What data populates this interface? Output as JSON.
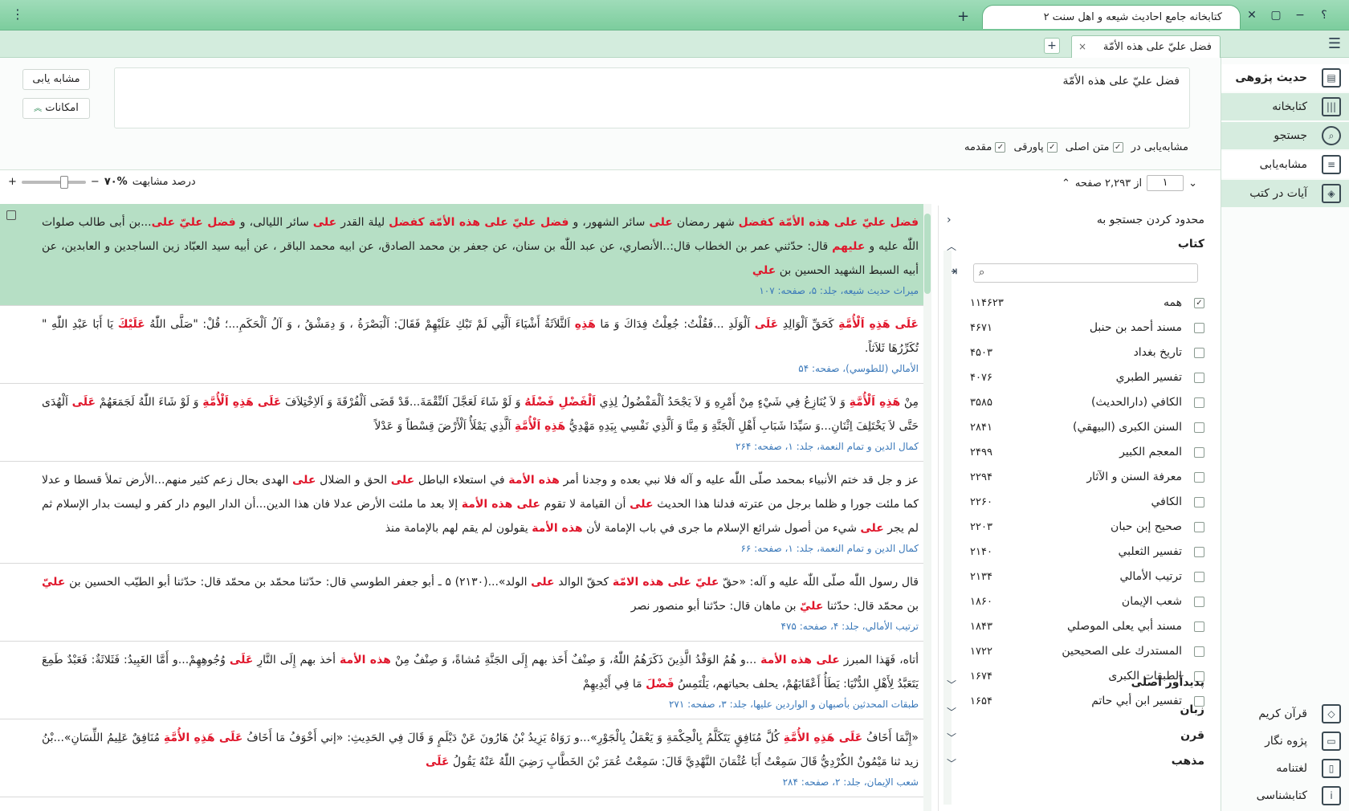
{
  "titlebar": {
    "app_title": "کتابخانه جامع احادیث شیعه و اهل سنت ۲",
    "help": "؟",
    "minimize": "−",
    "restore": "▢",
    "close": "✕",
    "new_tab": "+",
    "kebab": "⋮"
  },
  "doc_tabs": {
    "active_label": "فضل عليّ على هذه الأمّة",
    "close": "×",
    "add": "+"
  },
  "sidebar": {
    "menu": "☰",
    "items": [
      {
        "label": "حدیث پژوهی",
        "icon": "hadith-research-icon"
      },
      {
        "label": "کتابخانه",
        "icon": "library-icon"
      },
      {
        "label": "جستجو",
        "icon": "search-icon"
      },
      {
        "label": "مشابه‌یابی",
        "icon": "similarity-icon"
      },
      {
        "label": "آیات در کتب",
        "icon": "verses-icon"
      }
    ],
    "tools": [
      {
        "label": "قرآن کریم",
        "icon": "quran-icon"
      },
      {
        "label": "پژوه نگار",
        "icon": "notes-icon"
      },
      {
        "label": "لغتنامه",
        "icon": "dictionary-icon"
      },
      {
        "label": "کتابشناسی",
        "icon": "info-icon"
      }
    ]
  },
  "search": {
    "query": "فضل عليّ على هذه الأمّة",
    "similar_button": "مشابه یابی",
    "options_button": "امکانات",
    "scope_label": "مشابه‌یابی در",
    "checks": [
      {
        "label": "متن اصلی",
        "checked": true
      },
      {
        "label": "پاورقی",
        "checked": true
      },
      {
        "label": "مقدمه",
        "checked": true
      }
    ],
    "similarity_label": "درصد مشابهت",
    "similarity_value": "۷۰%",
    "minus": "−",
    "plus": "+"
  },
  "pager": {
    "current": "۱",
    "of_label": "از ۲,۲۹۳ صفحه"
  },
  "results": [
    {
      "text": [
        [
          "hi",
          "فضل عليّ على هذه الأمّة كفضل"
        ],
        [
          "n",
          " شهر رمضان "
        ],
        [
          "hi",
          "على"
        ],
        [
          "n",
          " سائر الشهور، و "
        ],
        [
          "hi",
          "فضل عليّ على هذه الأمّة كفضل"
        ],
        [
          "n",
          " ليلة القدر "
        ],
        [
          "hi",
          "على"
        ],
        [
          "n",
          " سائر الليالى، و "
        ],
        [
          "hi",
          "فضل عليّ على"
        ],
        [
          "n",
          "...بن أبى طالب صلوات اللّٰه عليه و "
        ],
        [
          "hi",
          "عليهم"
        ],
        [
          "n",
          " قال: حدّثني عمر بن الخطاب قال:..الأنصاري، عن عبد اللّٰه بن سنان، عن جعفر بن محمد الصادق، عن ابيه محمد الباقر ، عن أبيه سيد العبّاد زين الساجدين و العابدين، عن أبيه السبط الشهيد الحسين بن "
        ],
        [
          "hi",
          "علي"
        ]
      ],
      "ref": "ميراث حديث شيعه، جلد: ۵، صفحه: ۱۰۷"
    },
    {
      "text": [
        [
          "hi",
          "عَلَى هَذِهِ اَلْأُمَّةِ"
        ],
        [
          "n",
          " كَحَقِّ اَلْوَالِدِ "
        ],
        [
          "hi",
          "عَلَى"
        ],
        [
          "n",
          " اَلْوَلَدِ ...فَقُلْتُ: جُعِلْتُ فِدَاكَ وَ مَا "
        ],
        [
          "hi",
          "هَذِهِ"
        ],
        [
          "n",
          " اَلثَّلاَثَةُ أَشْيَاءَ اَلَّتِي لَمْ تَبْكِ عَلَيْهِمْ فَقَالَ: اَلْبَصْرَةُ ، وَ دِمَشْقُ ، وَ آلُ اَلْحَكَمِ...؛ قُلْ: \"صَلَّى اللّٰهُ "
        ],
        [
          "hi",
          "عَلَيْكَ"
        ],
        [
          "n",
          " يَا أَبَا عَبْدِ اللّٰهِ \" تُكَرِّرُهَا ثَلاَثاً."
        ]
      ],
      "ref": "الأمالي (للطوسي)، صفحه: ۵۴"
    },
    {
      "text": [
        [
          "n",
          "مِنْ "
        ],
        [
          "hi",
          "هَذِهِ اَلْأُمَّةِ"
        ],
        [
          "n",
          " وَ لاَ يُنَازِعُ فِي شَيْءٍ مِنْ أَمْرِهِ وَ لاَ يَجْحَدُ اَلْمَفْضُولُ لِذِي "
        ],
        [
          "hi",
          "اَلْفَضْلِ فَضْلَهُ"
        ],
        [
          "n",
          " وَ لَوْ شَاءَ لَعَجَّلَ اَلنِّقْمَةَ...قَدْ قَضَى اَلْفُرْقَةَ وَ اَلاِخْتِلاَفَ "
        ],
        [
          "hi",
          "عَلَى هَذِهِ اَلْأُمَّةِ"
        ],
        [
          "n",
          " وَ لَوْ شَاءَ اللّٰهُ لَجَمَعَهُمْ "
        ],
        [
          "hi",
          "عَلَى"
        ],
        [
          "n",
          " اَلْهُدَى حَتَّى لاَ يَخْتَلِفَ اِثْنَانِ...وَ سَيِّدَا شَبَابِ أَهْلِ اَلْجَنَّةِ وَ مِنَّا وَ اَلَّذِي نَفْسِي بِيَدِهِ مَهْدِيُّ "
        ],
        [
          "hi",
          "هَذِهِ اَلْأُمَّةِ"
        ],
        [
          "n",
          " اَلَّذِي يَمْلَأُ اَلْأَرْضَ قِسْطاً وَ عَدْلاً"
        ]
      ],
      "ref": "كمال الدين و تمام النعمة، جلد: ۱، صفحه: ۲۶۴"
    },
    {
      "text": [
        [
          "n",
          "عز و جل قد ختم الأنبياء بمحمد صلّى اللّٰه عليه و آله فلا نبي بعده و وجدنا أمر "
        ],
        [
          "hi",
          "هذه الأمة"
        ],
        [
          "n",
          " في استعلاء الباطل "
        ],
        [
          "hi",
          "على"
        ],
        [
          "n",
          " الحق و الضلال "
        ],
        [
          "hi",
          "على"
        ],
        [
          "n",
          " الهدى بحال زعم كثير منهم...الأرض تملأ قسطا و عدلا كما ملئت جورا و ظلما برجل من عترته فدلنا هذا الحديث "
        ],
        [
          "hi",
          "على"
        ],
        [
          "n",
          " أن القيامة لا تقوم "
        ],
        [
          "hi",
          "على هذه الأمة"
        ],
        [
          "n",
          " إلا بعد ما ملئت الأرض عدلا فان هذا الدين...أن الدار اليوم دار كفر و ليست بدار الإسلام ثم لم يجر "
        ],
        [
          "hi",
          "على"
        ],
        [
          "n",
          " شيء من أصول شرائع الإسلام ما جرى في باب الإمامة لأن "
        ],
        [
          "hi",
          "هذه الأمة"
        ],
        [
          "n",
          " يقولون لم يقم لهم بالإمامة منذ"
        ]
      ],
      "ref": "كمال الدين و تمام النعمة، جلد: ۱، صفحه: ۶۶"
    },
    {
      "text": [
        [
          "n",
          "قال رسول اللّٰه صلّى اللّٰه عليه و آله: «حقّ "
        ],
        [
          "hi",
          "عليّ على هذه الامّة"
        ],
        [
          "n",
          " كحقّ الوالد "
        ],
        [
          "hi",
          "على"
        ],
        [
          "n",
          " الولد»...(۲۱۳۰) ۵ ـ أبو جعفر الطوسي قال: حدّثنا محمّد بن محمّد قال: حدّثنا أبو الطيّب الحسين بن "
        ],
        [
          "hi",
          "عليّ"
        ],
        [
          "n",
          " بن محمّد قال: حدّثنا "
        ],
        [
          "hi",
          "عليّ"
        ],
        [
          "n",
          " بن ماهان قال: حدّثنا أبو منصور نصر"
        ]
      ],
      "ref": "ترتيب الأمالي، جلد: ۴، صفحه: ۴۷۵"
    },
    {
      "text": [
        [
          "n",
          "أتاه، فَهَذا المبرز "
        ],
        [
          "hi",
          "على هذه الأمة"
        ],
        [
          "n",
          " ...و هُمُ الوَفْدُ الَّذِينَ ذَكَرَهُمُ اللّٰهُ، وَ صِنْفٌ أَخَذ بهم إِلَى الجَنَّةِ مُشاةً، وَ صِنْفٌ مِنْ "
        ],
        [
          "hi",
          "هذه الأمة"
        ],
        [
          "n",
          " أخذ بهم إِلَى النَّارِ "
        ],
        [
          "hi",
          "عَلَى"
        ],
        [
          "n",
          " وُجُوهِهِمْ...و أَمَّا الغَبِيدُ: فَثَلاثَةٌ: فَعَبْدٌ طَمِعَ يَتَعَبَّدُ لِأَهْلِ الدُّنْيَا: يَطَأُ أَعْقَابَهُمْ، يحلف بحياتهم، يَلْتَمِسُ "
        ],
        [
          "hi",
          "فَضْلَ"
        ],
        [
          "n",
          " مَا فِي أَيْدِيهِمْ"
        ]
      ],
      "ref": "طبقات المحدثين بأصبهان و الواردين عليها، جلد: ۳، صفحه: ۲۷۱"
    },
    {
      "text": [
        [
          "n",
          "«إِنَّمَا أَخَافُ "
        ],
        [
          "hi",
          "عَلَى هَذِهِ الأُمَّةِ"
        ],
        [
          "n",
          " كُلَّ مُنَافِقٍ يَتَكَلَّمُ بِالْحِكْمَةِ وَ يَعْمَلُ بِالْجَوْرِ»...و رَوَاهُ يَزِيدُ بْنُ هَارُونَ عَنْ دَيْلَمٍ وَ قَالَ فِي الحَدِيثِ: «إني أَخْوَفُ مَا أَخَافُ "
        ],
        [
          "hi",
          "عَلَى هَذِهِ الأُمَّةِ"
        ],
        [
          "n",
          " مُنَافِقٌ عَلِيمُ اللِّسَانِ»...بْنُ زيد ثنا مَيْمُونٌ الكُرْدِيُّ قَالَ سَمِعْتُ أَبَا عُثْمَانَ النَّهْدِيَّ قَالَ: سَمِعْتُ عُمَرَ بْنَ الخَطَّابِ رَضِيَ اللّٰهُ عَنْهُ يَقُولُ "
        ],
        [
          "hi",
          "عَلَى"
        ]
      ],
      "ref": "شعب الإيمان، جلد: ۲، صفحه: ۲۸۴"
    }
  ],
  "filter": {
    "title": "محدود کردن جستجو به",
    "toggle": "‹",
    "books_section": "کتاب",
    "books": [
      {
        "name": "همه",
        "count": "۱۱۴۶۲۳",
        "checked": true
      },
      {
        "name": "مسند أحمد بن حنبل",
        "count": "۴۶۷۱",
        "checked": false
      },
      {
        "name": "تاريخ بغداد",
        "count": "۴۵۰۳",
        "checked": false
      },
      {
        "name": "تفسير الطبري",
        "count": "۴۰۷۶",
        "checked": false
      },
      {
        "name": "الكافي (دارالحديث)",
        "count": "۳۵۸۵",
        "checked": false
      },
      {
        "name": "السنن الكبرى (البيهقي)",
        "count": "۲۸۴۱",
        "checked": false
      },
      {
        "name": "المعجم الكبير",
        "count": "۲۴۹۹",
        "checked": false
      },
      {
        "name": "معرفة السنن و الآثار",
        "count": "۲۲۹۴",
        "checked": false
      },
      {
        "name": "الكافي",
        "count": "۲۲۶۰",
        "checked": false
      },
      {
        "name": "صحيح إبن حبان",
        "count": "۲۲۰۳",
        "checked": false
      },
      {
        "name": "تفسير الثعلبي",
        "count": "۲۱۴۰",
        "checked": false
      },
      {
        "name": "ترتيب الأمالي",
        "count": "۲۱۳۴",
        "checked": false
      },
      {
        "name": "شعب الإيمان",
        "count": "۱۸۶۰",
        "checked": false
      },
      {
        "name": "مسند أبي يعلى الموصلي",
        "count": "۱۸۴۳",
        "checked": false
      },
      {
        "name": "المستدرك على الصحيحين",
        "count": "۱۷۲۲",
        "checked": false
      },
      {
        "name": "الطبقات الكبرى",
        "count": "۱۶۷۴",
        "checked": false
      },
      {
        "name": "تفسير ابن أبي حاتم",
        "count": "۱۶۵۴",
        "checked": false
      }
    ],
    "sections": [
      "پدیدآور اصلی",
      "زبان",
      "قرن",
      "مذهب"
    ]
  }
}
